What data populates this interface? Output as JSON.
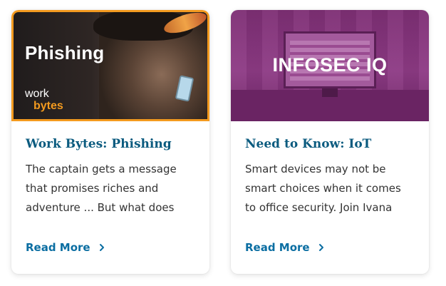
{
  "cards": [
    {
      "thumb_text": "Phishing",
      "brand_line1": "work",
      "brand_line2": "bytes",
      "title": "Work Bytes: Phishing",
      "description": "The captain gets a message that promises riches and adventure ... But what does th...",
      "cta": "Read More"
    },
    {
      "thumb_text": "INFOSEC IQ",
      "title": "Need to Know: IoT",
      "description": "Smart devices may not be smart choices when it comes to office security. Join Ivana and...",
      "cta": "Read More"
    }
  ],
  "colors": {
    "accent_orange": "#f39a1f",
    "title_blue": "#0b5b7f",
    "link_blue": "#0b6ea2",
    "purple": "#8e3b85"
  }
}
